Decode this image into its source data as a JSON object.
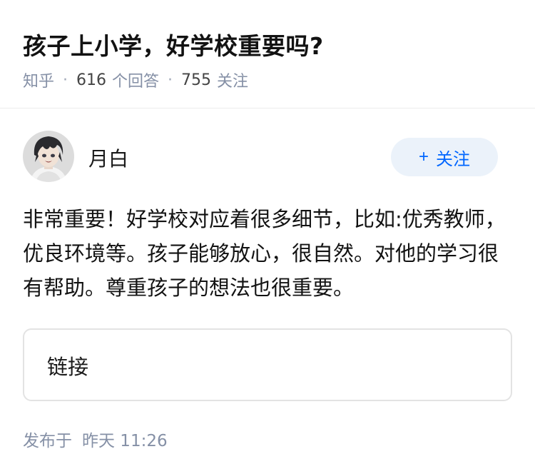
{
  "question": {
    "title": "孩子上小学，好学校重要吗?",
    "source": "知乎",
    "separator": "·",
    "answer_count": "616",
    "answer_label": "个回答",
    "follow_count": "755",
    "follow_label": "关注"
  },
  "answer": {
    "author_name": "月白",
    "avatar_icon": "user-avatar-anime-boy",
    "follow_button_label": "关注",
    "follow_button_icon": "plus-icon",
    "content": "非常重要！好学校对应着很多细节，比如:优秀教师，优良环境等。孩子能够放心，很自然。对他的学习很有帮助。尊重孩子的想法也很重要。",
    "link_label": "链接",
    "publish_prefix": "发布于",
    "publish_time": "昨天 11:26"
  },
  "colors": {
    "accent": "#0066ff",
    "follow_bg": "#ebf2fa",
    "meta_gray": "#8590a6"
  }
}
